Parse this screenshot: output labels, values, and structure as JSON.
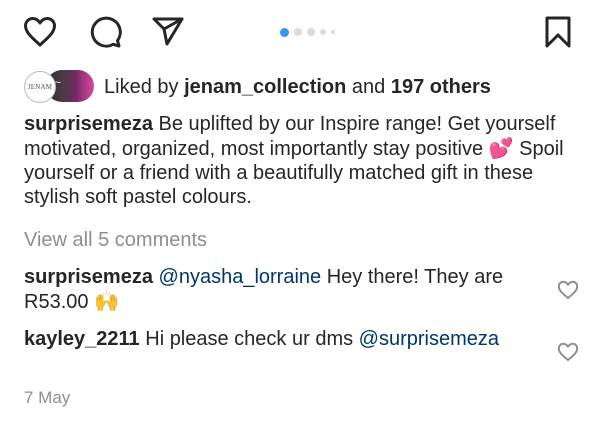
{
  "actions": {
    "like_icon": "heart-icon",
    "comment_icon": "comment-icon",
    "share_icon": "send-icon",
    "save_icon": "bookmark-icon"
  },
  "carousel": {
    "dot_count": 5,
    "active_index": 0,
    "active_color": "#3897f0",
    "inactive_color": "#dbdbdb"
  },
  "likes": {
    "avatar_text": "JENAM",
    "prefix": "Liked by ",
    "user": "jenam_collection",
    "middle": " and ",
    "others": "197 others"
  },
  "caption": {
    "username": "surprisemeza",
    "text_before_emoji": " Be uplifted by our Inspire range! Get yourself motivated, organized, most importantly stay positive ",
    "emoji": "💕",
    "text_after_emoji": " Spoil yourself or a friend with a beautifully matched gift in these stylish soft pastel colours."
  },
  "view_all_comments": "View all 5 comments",
  "comments": [
    {
      "username": "surprisemeza",
      "mention": "@nyasha_lorraine",
      "text": " Hey there! They are R53.00 ",
      "emoji": "🙌"
    },
    {
      "username": "kayley_2211",
      "text": " Hi please check ur dms ",
      "mention": "@surprisemeza"
    }
  ],
  "date": "7 May",
  "colors": {
    "text": "#262626",
    "secondary": "#8e8e8e",
    "mention": "#00376b"
  }
}
